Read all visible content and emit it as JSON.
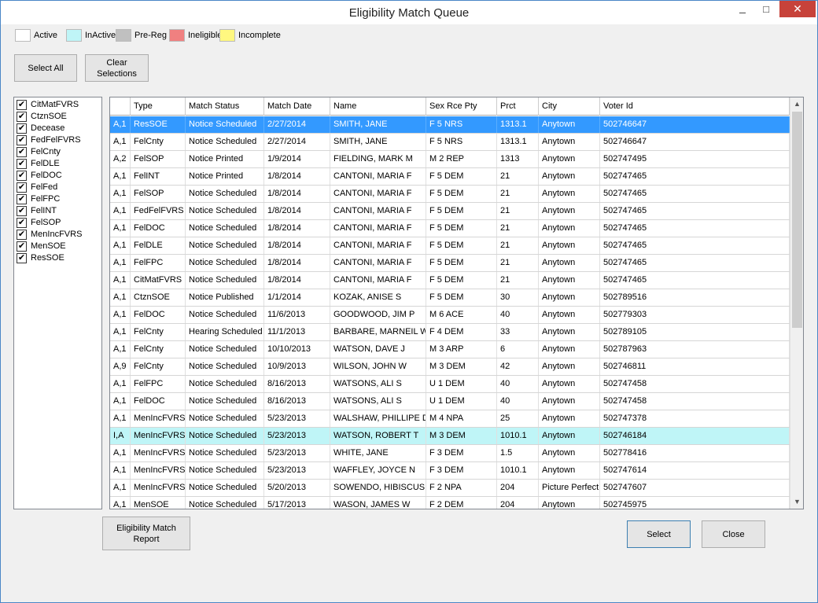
{
  "window": {
    "title": "Eligibility Match Queue",
    "minimize_glyph": "_",
    "maximize_glyph": "□",
    "close_glyph": "✕"
  },
  "legend": [
    {
      "label": "Active",
      "color": "#ffffff"
    },
    {
      "label": "InActive",
      "color": "#bff5f7"
    },
    {
      "label": "Pre-Reg",
      "color": "#c0c0c0"
    },
    {
      "label": "Ineligible",
      "color": "#f08080"
    },
    {
      "label": "Incomplete",
      "color": "#fff880"
    }
  ],
  "buttons": {
    "select_all": "Select All",
    "clear_selections": "Clear Selections",
    "eligibility_report": "Eligibility Match Report",
    "select": "Select",
    "close": "Close"
  },
  "filters": [
    {
      "label": "CitMatFVRS",
      "checked": true
    },
    {
      "label": "CtznSOE",
      "checked": true
    },
    {
      "label": "Decease",
      "checked": true
    },
    {
      "label": "FedFelFVRS",
      "checked": true
    },
    {
      "label": "FelCnty",
      "checked": true
    },
    {
      "label": "FelDLE",
      "checked": true
    },
    {
      "label": "FelDOC",
      "checked": true
    },
    {
      "label": "FelFed",
      "checked": true
    },
    {
      "label": "FelFPC",
      "checked": true
    },
    {
      "label": "FelINT",
      "checked": true
    },
    {
      "label": "FelSOP",
      "checked": true
    },
    {
      "label": "MenIncFVRS",
      "checked": true
    },
    {
      "label": "MenSOE",
      "checked": true
    },
    {
      "label": "ResSOE",
      "checked": true
    }
  ],
  "check_glyph": "✔",
  "table": {
    "columns": [
      "",
      "Type",
      "Match Status",
      "Match Date",
      "Name",
      "Sex Rce Pty",
      "Prct",
      "City",
      "Voter Id"
    ],
    "rows": [
      {
        "status": "selected",
        "cells": [
          "A,1",
          "ResSOE",
          "Notice Scheduled",
          "2/27/2014",
          "SMITH, JANE",
          "F    5    NRS",
          "1313.1",
          "Anytown",
          "502746647"
        ]
      },
      {
        "status": "active",
        "cells": [
          "A,1",
          "FelCnty",
          "Notice Scheduled",
          "2/27/2014",
          "SMITH, JANE",
          "F    5    NRS",
          "1313.1",
          "Anytown",
          "502746647"
        ]
      },
      {
        "status": "active",
        "cells": [
          "A,2",
          "FelSOP",
          "Notice Printed",
          "1/9/2014",
          "FIELDING, MARK M",
          "M    2    REP",
          "1313",
          "Anytown",
          "502747495"
        ]
      },
      {
        "status": "active",
        "cells": [
          "A,1",
          "FelINT",
          "Notice Printed",
          "1/8/2014",
          "CANTONI, MARIA F",
          "F    5    DEM",
          "21",
          "Anytown",
          "502747465"
        ]
      },
      {
        "status": "active",
        "cells": [
          "A,1",
          "FelSOP",
          "Notice Scheduled",
          "1/8/2014",
          "CANTONI, MARIA F",
          "F    5    DEM",
          "21",
          "Anytown",
          "502747465"
        ]
      },
      {
        "status": "active",
        "cells": [
          "A,1",
          "FedFelFVRS",
          "Notice Scheduled",
          "1/8/2014",
          "CANTONI, MARIA F",
          "F    5    DEM",
          "21",
          "Anytown",
          "502747465"
        ]
      },
      {
        "status": "active",
        "cells": [
          "A,1",
          "FelDOC",
          "Notice Scheduled",
          "1/8/2014",
          "CANTONI, MARIA F",
          "F    5    DEM",
          "21",
          "Anytown",
          "502747465"
        ]
      },
      {
        "status": "active",
        "cells": [
          "A,1",
          "FelDLE",
          "Notice Scheduled",
          "1/8/2014",
          "CANTONI, MARIA F",
          "F    5    DEM",
          "21",
          "Anytown",
          "502747465"
        ]
      },
      {
        "status": "active",
        "cells": [
          "A,1",
          "FelFPC",
          "Notice Scheduled",
          "1/8/2014",
          "CANTONI, MARIA F",
          "F    5    DEM",
          "21",
          "Anytown",
          "502747465"
        ]
      },
      {
        "status": "active",
        "cells": [
          "A,1",
          "CitMatFVRS",
          "Notice Scheduled",
          "1/8/2014",
          "CANTONI, MARIA F",
          "F    5    DEM",
          "21",
          "Anytown",
          "502747465"
        ]
      },
      {
        "status": "active",
        "cells": [
          "A,1",
          "CtznSOE",
          "Notice Published",
          "1/1/2014",
          "KOZAK, ANISE S",
          "F    5    DEM",
          "30",
          "Anytown",
          "502789516"
        ]
      },
      {
        "status": "active",
        "cells": [
          "A,1",
          "FelDOC",
          "Notice Scheduled",
          "11/6/2013",
          "GOODWOOD, JIM P",
          "M    6    ACE",
          "40",
          "Anytown",
          "502779303"
        ]
      },
      {
        "status": "active",
        "cells": [
          "A,1",
          "FelCnty",
          "Hearing Scheduled",
          "11/1/2013",
          "BARBARE, MARNEIL W",
          "F    4    DEM",
          "33",
          "Anytown",
          "502789105"
        ]
      },
      {
        "status": "active",
        "cells": [
          "A,1",
          "FelCnty",
          "Notice Scheduled",
          "10/10/2013",
          "WATSON, DAVE J",
          "M    3    ARP",
          "6",
          "Anytown",
          "502787963"
        ]
      },
      {
        "status": "active",
        "cells": [
          "A,9",
          "FelCnty",
          "Notice Scheduled",
          "10/9/2013",
          "WILSON, JOHN W",
          "M    3    DEM",
          "42",
          "Anytown",
          "502746811"
        ]
      },
      {
        "status": "active",
        "cells": [
          "A,1",
          "FelFPC",
          "Notice Scheduled",
          "8/16/2013",
          "WATSONS, ALI S",
          "U    1    DEM",
          "40",
          "Anytown",
          "502747458"
        ]
      },
      {
        "status": "active",
        "cells": [
          "A,1",
          "FelDOC",
          "Notice Scheduled",
          "8/16/2013",
          "WATSONS, ALI S",
          "U    1    DEM",
          "40",
          "Anytown",
          "502747458"
        ]
      },
      {
        "status": "active",
        "cells": [
          "A,1",
          "MenIncFVRS",
          "Notice Scheduled",
          "5/23/2013",
          "WALSHAW, PHILLIPE D",
          "M    4    NPA",
          "25",
          "Anytown",
          "502747378"
        ]
      },
      {
        "status": "inactive",
        "cells": [
          "I,A",
          "MenIncFVRS",
          "Notice Scheduled",
          "5/23/2013",
          "WATSON, ROBERT T",
          "M    3    DEM",
          "1010.1",
          "Anytown",
          "502746184"
        ]
      },
      {
        "status": "active",
        "cells": [
          "A,1",
          "MenIncFVRS",
          "Notice Scheduled",
          "5/23/2013",
          "WHITE, JANE",
          "F    3    DEM",
          "1.5",
          "Anytown",
          "502778416"
        ]
      },
      {
        "status": "active",
        "cells": [
          "A,1",
          "MenIncFVRS",
          "Notice Scheduled",
          "5/23/2013",
          "WAFFLEY, JOYCE N",
          "F    3    DEM",
          "1010.1",
          "Anytown",
          "502747614"
        ]
      },
      {
        "status": "active",
        "cells": [
          "A,1",
          "MenIncFVRS",
          "Notice Scheduled",
          "5/20/2013",
          "SOWENDO, HIBISCUS",
          "F    2    NPA",
          "204",
          "Picture Perfect",
          "502747607"
        ]
      },
      {
        "status": "active",
        "cells": [
          "A,1",
          "MenSOE",
          "Notice Scheduled",
          "5/17/2013",
          "WASON, JAMES W",
          "F    2    DEM",
          "204",
          "Anytown",
          "502745975"
        ]
      }
    ]
  },
  "scrollbar": {
    "up_glyph": "▲",
    "down_glyph": "▼"
  }
}
